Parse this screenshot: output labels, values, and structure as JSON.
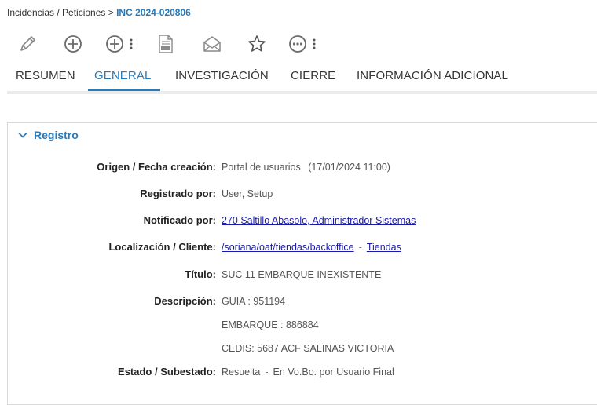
{
  "breadcrumb": {
    "path": "Incidencias / Peticiones >",
    "current": "INC 2024-020806"
  },
  "toolbar": {
    "icons": [
      "pencil-icon",
      "plus-circle-icon",
      "plus-circle-menu-icon",
      "pdf-icon",
      "envelope-icon",
      "star-icon",
      "more-circle-menu-icon"
    ]
  },
  "tabs": [
    {
      "label": "RESUMEN",
      "active": false
    },
    {
      "label": "GENERAL",
      "active": true
    },
    {
      "label": "INVESTIGACIÓN",
      "active": false
    },
    {
      "label": "CIERRE",
      "active": false
    },
    {
      "label": "INFORMACIÓN ADICIONAL",
      "active": false
    }
  ],
  "section": {
    "title": "Registro"
  },
  "fields": {
    "origen": {
      "label": "Origen / Fecha creación:",
      "value": "Portal de usuarios",
      "date": "(17/01/2024 11:00)"
    },
    "registrado": {
      "label": "Registrado por:",
      "value": "User, Setup"
    },
    "notificado": {
      "label": "Notificado por:",
      "value": "270 Saltillo Abasolo, Administrador Sistemas"
    },
    "localizacion": {
      "label": "Localización / Cliente:",
      "link1": "/soriana/oat/tiendas/backoffice",
      "sep": "-",
      "link2": "Tiendas"
    },
    "titulo": {
      "label": "Título:",
      "value": "SUC 11 EMBARQUE INEXISTENTE"
    },
    "descripcion": {
      "label": "Descripción:",
      "lines": [
        "GUIA : 951194",
        "EMBARQUE : 886884",
        "CEDIS: 5687 ACF SALINAS VICTORIA"
      ]
    },
    "estado": {
      "label": "Estado / Subestado:",
      "value": "Resuelta",
      "sep": "-",
      "sub": "En Vo.Bo. por Usuario Final"
    }
  },
  "colors": {
    "accent": "#2a7ab8",
    "link": "#1a1aa8",
    "text": "#333333"
  }
}
